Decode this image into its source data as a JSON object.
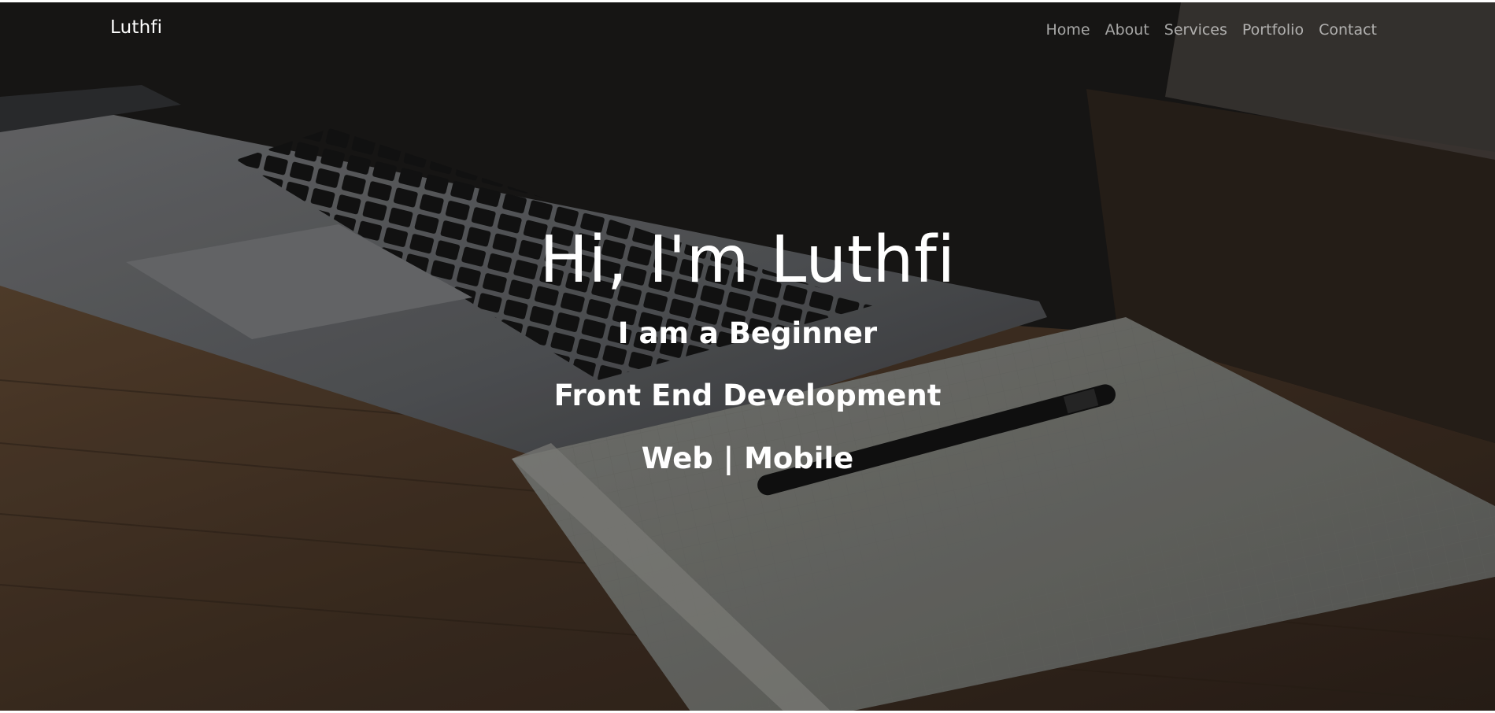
{
  "navbar": {
    "brand": "Luthfi",
    "links": [
      "Home",
      "About",
      "Services",
      "Portfolio",
      "Contact"
    ]
  },
  "hero": {
    "headline": "Hi, I'm Luthfi",
    "lines": [
      "I am a Beginner",
      "Front End Development",
      "Web | Mobile"
    ],
    "background_image": "laptop-and-notebook-on-wooden-desk-photo"
  },
  "colors": {
    "text": "#ffffff",
    "nav_link": "#b9b9b9",
    "background": "#1f1c1a"
  }
}
